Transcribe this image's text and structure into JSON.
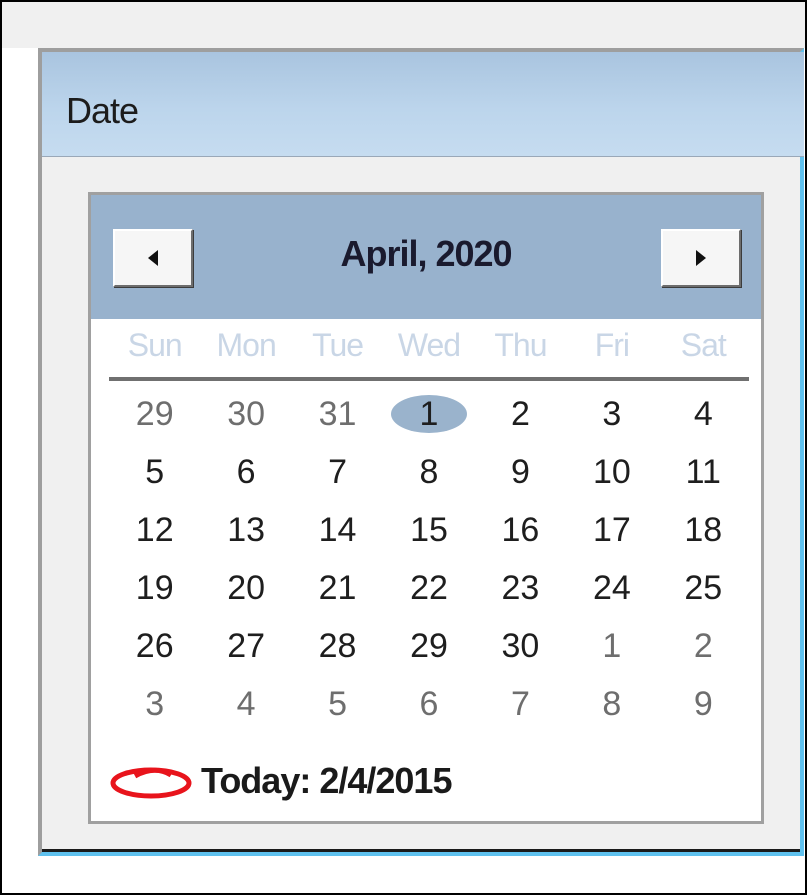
{
  "window": {
    "title": "Date"
  },
  "calendar": {
    "month_label": "April, 2020",
    "weekdays": [
      "Sun",
      "Mon",
      "Tue",
      "Wed",
      "Thu",
      "Fri",
      "Sat"
    ],
    "weeks": [
      [
        "29",
        "30",
        "31",
        "1",
        "2",
        "3",
        "4"
      ],
      [
        "5",
        "6",
        "7",
        "8",
        "9",
        "10",
        "11"
      ],
      [
        "12",
        "13",
        "14",
        "15",
        "16",
        "17",
        "18"
      ],
      [
        "19",
        "20",
        "21",
        "22",
        "23",
        "24",
        "25"
      ],
      [
        "26",
        "27",
        "28",
        "29",
        "30",
        "1",
        "2"
      ],
      [
        "3",
        "4",
        "5",
        "6",
        "7",
        "8",
        "9"
      ]
    ],
    "selected_day": "1",
    "today_label": "Today: 2/4/2015",
    "colors": {
      "header_bg": "#98b2cd",
      "selection": "#9ab3cc",
      "today_marker": "#e8141c",
      "weekday_text": "#c9d6e6"
    },
    "icons": {
      "prev": "triangle-left-icon",
      "next": "triangle-right-icon",
      "today": "red-ellipse-icon"
    }
  }
}
